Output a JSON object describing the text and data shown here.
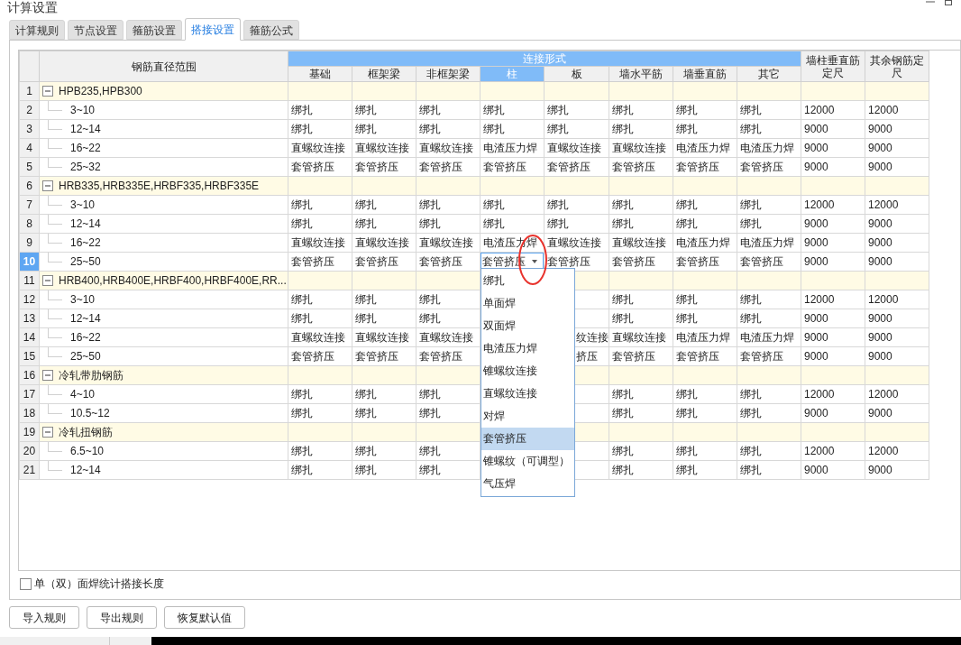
{
  "window": {
    "title": "计算设置"
  },
  "tabs": [
    {
      "label": "计算规则",
      "selected": false
    },
    {
      "label": "节点设置",
      "selected": false
    },
    {
      "label": "箍筋设置",
      "selected": false
    },
    {
      "label": "搭接设置",
      "selected": true
    },
    {
      "label": "箍筋公式",
      "selected": false
    }
  ],
  "table": {
    "name_column": "钢筋直径范围",
    "group_header": "连接形式",
    "columns": [
      {
        "label": "基础",
        "selected": false
      },
      {
        "label": "框架梁",
        "selected": false
      },
      {
        "label": "非框架梁",
        "selected": false
      },
      {
        "label": "柱",
        "selected": true
      },
      {
        "label": "板",
        "selected": false
      },
      {
        "label": "墙水平筋",
        "selected": false
      },
      {
        "label": "墙垂直筋",
        "selected": false
      },
      {
        "label": "其它",
        "selected": false
      }
    ],
    "length_columns": [
      "墙柱垂直筋定尺",
      "其余钢筋定尺"
    ],
    "rows": [
      {
        "num": "1",
        "kind": "group",
        "name": "HPB235,HPB300",
        "expanded": true,
        "selected": false
      },
      {
        "num": "2",
        "kind": "item",
        "name": "3~10",
        "cells": [
          "绑扎",
          "绑扎",
          "绑扎",
          "绑扎",
          "绑扎",
          "绑扎",
          "绑扎",
          "绑扎"
        ],
        "lengths": [
          "12000",
          "12000"
        ],
        "selected": false
      },
      {
        "num": "3",
        "kind": "item",
        "name": "12~14",
        "cells": [
          "绑扎",
          "绑扎",
          "绑扎",
          "绑扎",
          "绑扎",
          "绑扎",
          "绑扎",
          "绑扎"
        ],
        "lengths": [
          "9000",
          "9000"
        ],
        "selected": false
      },
      {
        "num": "4",
        "kind": "item",
        "name": "16~22",
        "cells": [
          "直螺纹连接",
          "直螺纹连接",
          "直螺纹连接",
          "电渣压力焊",
          "直螺纹连接",
          "直螺纹连接",
          "电渣压力焊",
          "电渣压力焊"
        ],
        "lengths": [
          "9000",
          "9000"
        ],
        "selected": false
      },
      {
        "num": "5",
        "kind": "item",
        "name": "25~32",
        "cells": [
          "套管挤压",
          "套管挤压",
          "套管挤压",
          "套管挤压",
          "套管挤压",
          "套管挤压",
          "套管挤压",
          "套管挤压"
        ],
        "lengths": [
          "9000",
          "9000"
        ],
        "selected": false
      },
      {
        "num": "6",
        "kind": "group",
        "name": "HRB335,HRB335E,HRBF335,HRBF335E",
        "expanded": true,
        "selected": false
      },
      {
        "num": "7",
        "kind": "item",
        "name": "3~10",
        "cells": [
          "绑扎",
          "绑扎",
          "绑扎",
          "绑扎",
          "绑扎",
          "绑扎",
          "绑扎",
          "绑扎"
        ],
        "lengths": [
          "12000",
          "12000"
        ],
        "selected": false
      },
      {
        "num": "8",
        "kind": "item",
        "name": "12~14",
        "cells": [
          "绑扎",
          "绑扎",
          "绑扎",
          "绑扎",
          "绑扎",
          "绑扎",
          "绑扎",
          "绑扎"
        ],
        "lengths": [
          "9000",
          "9000"
        ],
        "selected": false
      },
      {
        "num": "9",
        "kind": "item",
        "name": "16~22",
        "cells": [
          "直螺纹连接",
          "直螺纹连接",
          "直螺纹连接",
          "电渣压力焊",
          "直螺纹连接",
          "直螺纹连接",
          "电渣压力焊",
          "电渣压力焊"
        ],
        "lengths": [
          "9000",
          "9000"
        ],
        "selected": false
      },
      {
        "num": "10",
        "kind": "item",
        "name": "25~50",
        "cells": [
          "套管挤压",
          "套管挤压",
          "套管挤压",
          "套管挤压",
          "套管挤压",
          "套管挤压",
          "套管挤压",
          "套管挤压"
        ],
        "lengths": [
          "9000",
          "9000"
        ],
        "selected": true
      },
      {
        "num": "11",
        "kind": "group",
        "name": "HRB400,HRB400E,HRBF400,HRBF400E,RR...",
        "expanded": true,
        "selected": false
      },
      {
        "num": "12",
        "kind": "item",
        "name": "3~10",
        "cells": [
          "绑扎",
          "绑扎",
          "绑扎",
          null,
          null,
          "绑扎",
          "绑扎",
          "绑扎"
        ],
        "lengths": [
          "12000",
          "12000"
        ],
        "selected": false
      },
      {
        "num": "13",
        "kind": "item",
        "name": "12~14",
        "cells": [
          "绑扎",
          "绑扎",
          "绑扎",
          null,
          null,
          "绑扎",
          "绑扎",
          "绑扎"
        ],
        "lengths": [
          "9000",
          "9000"
        ],
        "selected": false
      },
      {
        "num": "14",
        "kind": "item",
        "name": "16~22",
        "cells": [
          "直螺纹连接",
          "直螺纹连接",
          "直螺纹连接",
          null,
          "纹连接",
          "直螺纹连接",
          "电渣压力焊",
          "电渣压力焊"
        ],
        "lengths": [
          "9000",
          "9000"
        ],
        "selected": false
      },
      {
        "num": "15",
        "kind": "item",
        "name": "25~50",
        "cells": [
          "套管挤压",
          "套管挤压",
          "套管挤压",
          null,
          "挤压",
          "套管挤压",
          "套管挤压",
          "套管挤压"
        ],
        "lengths": [
          "9000",
          "9000"
        ],
        "selected": false
      },
      {
        "num": "16",
        "kind": "group",
        "name": "冷轧带肋钢筋",
        "expanded": true,
        "selected": false
      },
      {
        "num": "17",
        "kind": "item",
        "name": "4~10",
        "cells": [
          "绑扎",
          "绑扎",
          "绑扎",
          null,
          null,
          "绑扎",
          "绑扎",
          "绑扎"
        ],
        "lengths": [
          "12000",
          "12000"
        ],
        "selected": false
      },
      {
        "num": "18",
        "kind": "item",
        "name": "10.5~12",
        "cells": [
          "绑扎",
          "绑扎",
          "绑扎",
          null,
          null,
          "绑扎",
          "绑扎",
          "绑扎"
        ],
        "lengths": [
          "9000",
          "9000"
        ],
        "selected": false
      },
      {
        "num": "19",
        "kind": "group",
        "name": "冷轧扭钢筋",
        "expanded": true,
        "selected": false
      },
      {
        "num": "20",
        "kind": "item",
        "name": "6.5~10",
        "cells": [
          "绑扎",
          "绑扎",
          "绑扎",
          null,
          null,
          "绑扎",
          "绑扎",
          "绑扎"
        ],
        "lengths": [
          "12000",
          "12000"
        ],
        "selected": false
      },
      {
        "num": "21",
        "kind": "item",
        "name": "12~14",
        "cells": [
          "绑扎",
          "绑扎",
          "绑扎",
          null,
          null,
          "绑扎",
          "绑扎",
          "绑扎"
        ],
        "lengths": [
          "9000",
          "9000"
        ],
        "selected": false
      }
    ]
  },
  "dropdown": {
    "items": [
      {
        "label": "绑扎",
        "selected": false
      },
      {
        "label": "单面焊",
        "selected": false
      },
      {
        "label": "双面焊",
        "selected": false
      },
      {
        "label": "电渣压力焊",
        "selected": false
      },
      {
        "label": "锥螺纹连接",
        "selected": false
      },
      {
        "label": "直螺纹连接",
        "selected": false
      },
      {
        "label": "对焊",
        "selected": false
      },
      {
        "label": "套管挤压",
        "selected": true
      },
      {
        "label": "锥螺纹（可调型）",
        "selected": false
      },
      {
        "label": "气压焊",
        "selected": false
      }
    ]
  },
  "option": {
    "label": "单（双）面焊统计搭接长度",
    "checked": false
  },
  "buttons": [
    "导入规则",
    "导出规则",
    "恢复默认值"
  ]
}
